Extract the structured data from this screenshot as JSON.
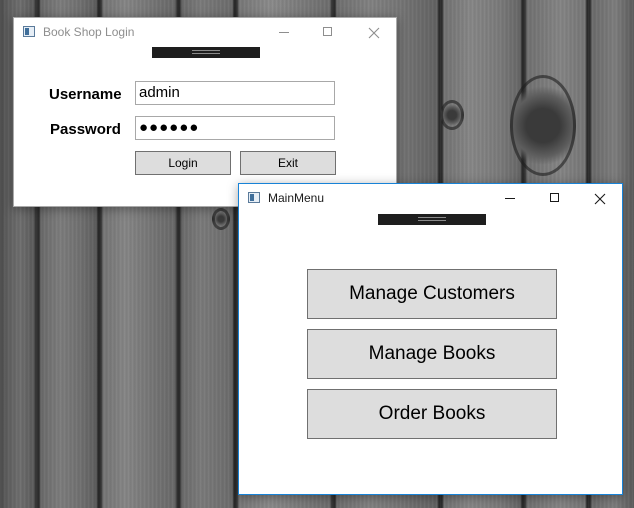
{
  "login_window": {
    "title": "Book Shop Login",
    "username_label": "Username",
    "username_value": "admin",
    "password_label": "Password",
    "password_value": "●●●●●●",
    "login_label": "Login",
    "exit_label": "Exit"
  },
  "main_window": {
    "title": "MainMenu",
    "buttons": [
      "Manage Customers",
      "Manage Books",
      "Order Books"
    ]
  },
  "icons": {
    "app_icon": "window-app-icon",
    "minimize": "minimize-icon",
    "maximize": "maximize-icon",
    "close": "close-icon"
  },
  "colors": {
    "active_border": "#1883d7",
    "button_face": "#dddddd",
    "button_border": "#707070"
  }
}
